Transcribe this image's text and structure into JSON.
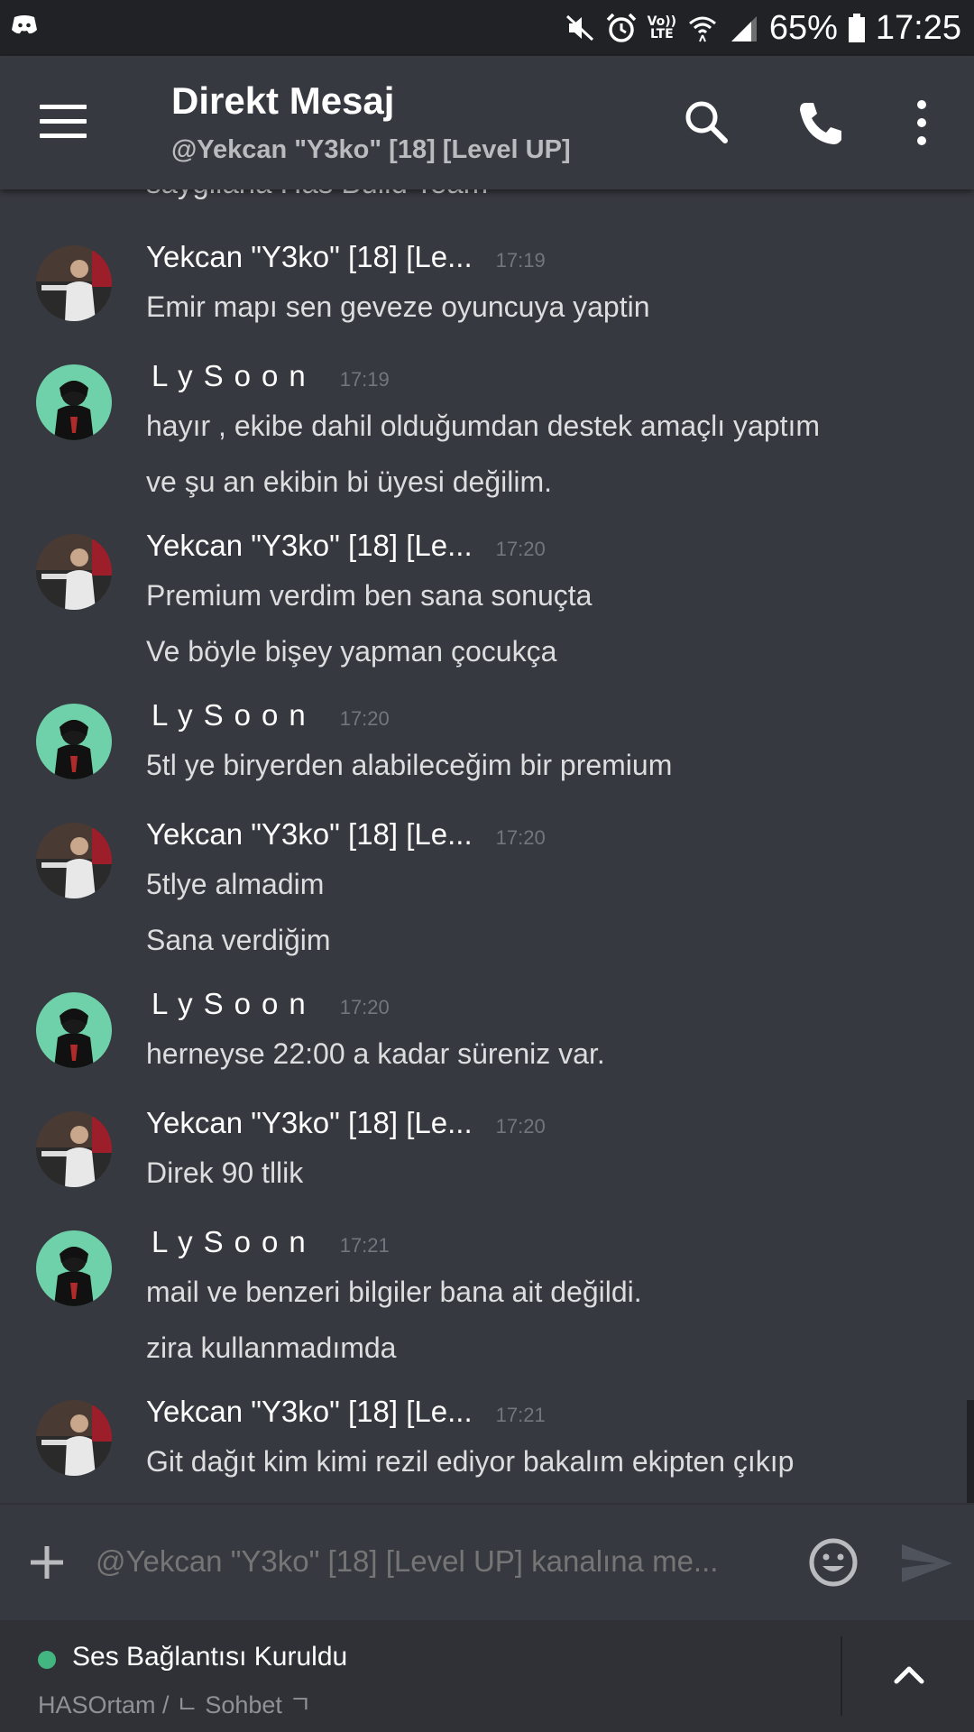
{
  "status_bar": {
    "battery": "65%",
    "time": "17:25",
    "network_badge_top": "Vo))",
    "network_badge_bottom": "LTE",
    "icons": [
      "discord-icon",
      "mute-icon",
      "alarm-icon",
      "wifi-icon",
      "signal-icon",
      "battery-icon"
    ]
  },
  "header": {
    "title": "Direkt Mesaj",
    "subtitle": "@Yekcan \"Y3ko\" [18] [Level UP]",
    "icons": [
      "menu-icon",
      "search-icon",
      "phone-icon",
      "more-vert-icon"
    ]
  },
  "conversation": {
    "partial_top_line": "saygilarla Has Build Team",
    "messages": [
      {
        "author": "Yekcan \"Y3ko\" [18] [Le...",
        "time": "17:19",
        "lines": [
          "Emir mapı sen geveze oyuncuya yaptin"
        ]
      },
      {
        "author": "LySoon",
        "time": "17:19",
        "lines": [
          "hayır , ekibe dahil olduğumdan destek amaçlı yaptım",
          "ve şu an ekibin bi üyesi değilim."
        ]
      },
      {
        "author": "Yekcan \"Y3ko\" [18] [Le...",
        "time": "17:20",
        "lines": [
          "Premium verdim ben sana sonuçta",
          "Ve böyle bişey yapman çocukça"
        ]
      },
      {
        "author": "LySoon",
        "time": "17:20",
        "lines": [
          "5tl ye biryerden alabileceğim bir premium"
        ]
      },
      {
        "author": "Yekcan \"Y3ko\" [18] [Le...",
        "time": "17:20",
        "lines": [
          "5tlye almadim",
          "Sana verdiğim"
        ]
      },
      {
        "author": "LySoon",
        "time": "17:20",
        "lines": [
          "herneyse 22:00 a kadar süreniz var."
        ]
      },
      {
        "author": "Yekcan \"Y3ko\" [18] [Le...",
        "time": "17:20",
        "lines": [
          "Direk 90 tllik"
        ]
      },
      {
        "author": "LySoon",
        "time": "17:21",
        "lines": [
          "mail ve benzeri bilgiler bana ait değildi.",
          "zira kullanmadımda"
        ]
      },
      {
        "author": "Yekcan \"Y3ko\" [18] [Le...",
        "time": "17:21",
        "lines": [
          "Git dağıt kim kimi rezil ediyor bakalım ekipten çıkıp"
        ]
      }
    ]
  },
  "composer": {
    "placeholder": "@Yekcan \"Y3ko\" [18] [Level UP] kanalına me...",
    "icons": [
      "plus-icon",
      "emoji-icon",
      "send-icon"
    ]
  },
  "voice_panel": {
    "status": "Ses Bağlantısı Kuruldu",
    "channel": "HASOrtam / ㄴ Sohbet ㄱ",
    "status_color": "#43b581",
    "icons": [
      "chevron-up-icon"
    ]
  },
  "colors": {
    "background": "#36393f",
    "status_bar": "#202225",
    "panel": "#2f3136",
    "muted_text": "#72767d"
  }
}
